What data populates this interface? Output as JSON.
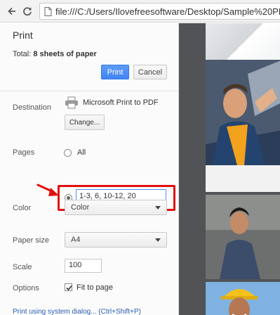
{
  "browser": {
    "url": "file:///C:/Users/Ilovefreesoftware/Desktop/Sample%20PDF%20fil"
  },
  "print_dialog": {
    "title": "Print",
    "summary_prefix": "Total: ",
    "summary_value": "8 sheets of paper",
    "print_button": "Print",
    "cancel_button": "Cancel",
    "destination": {
      "label": "Destination",
      "printer_name": "Microsoft Print to PDF",
      "change_button": "Change..."
    },
    "pages": {
      "label": "Pages",
      "option_all": "All",
      "custom_value": "1-3, 6, 10-12, 20",
      "selected": "custom"
    },
    "color": {
      "label": "Color",
      "value": "Color"
    },
    "paper_size": {
      "label": "Paper size",
      "value": "A4"
    },
    "scale": {
      "label": "Scale",
      "value": "100"
    },
    "options": {
      "label": "Options",
      "fit_to_page": "Fit to page",
      "fit_to_page_checked": true
    },
    "system_dialog_link": "Print using system dialog... (Ctrl+Shift+P)"
  },
  "colors": {
    "accent": "#4285f4",
    "highlight": "#e10f0f",
    "preview_bg": "#515356"
  }
}
